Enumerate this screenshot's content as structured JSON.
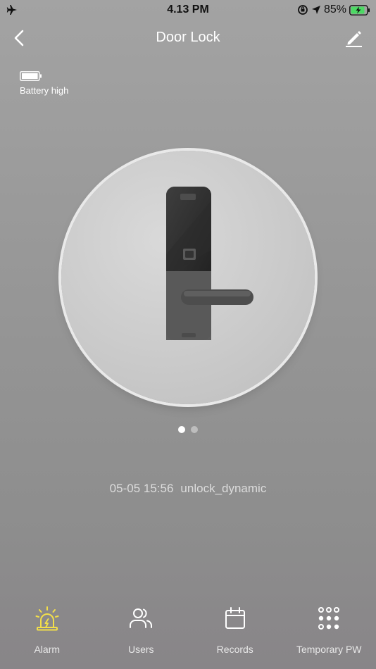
{
  "status_bar": {
    "time": "4.13 PM",
    "battery_percent": "85%"
  },
  "header": {
    "title": "Door Lock"
  },
  "battery": {
    "label": "Battery high"
  },
  "pager": {
    "pages": 2,
    "active": 0
  },
  "last_record": {
    "timestamp": "05-05 15:56",
    "event": "unlock_dynamic"
  },
  "tabs": [
    {
      "label": "Alarm",
      "icon": "alarm-siren-icon",
      "active": true
    },
    {
      "label": "Users",
      "icon": "users-icon",
      "active": false
    },
    {
      "label": "Records",
      "icon": "calendar-icon",
      "active": false
    },
    {
      "label": "Temporary PW",
      "icon": "keypad-icon",
      "active": false
    }
  ],
  "colors": {
    "accent_active": "#f3df49",
    "tab_inactive": "#ffffff",
    "charging_green": "#4cd964"
  }
}
